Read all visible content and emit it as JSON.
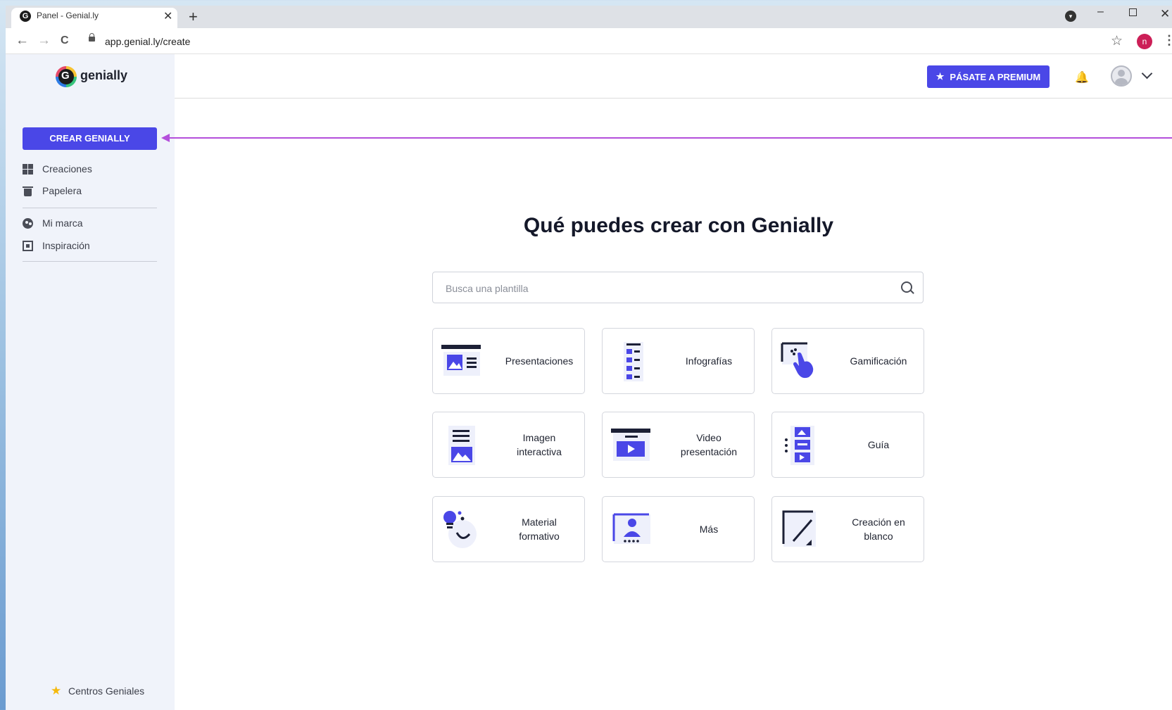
{
  "browser": {
    "tab_title": "Panel - Genial.ly",
    "favicon_letter": "G",
    "tab_close": "✕",
    "new_tab": "+",
    "url": "app.genial.ly/create",
    "profile_initial": "n",
    "icons": {
      "back": "←",
      "forward": "→",
      "reload": "C",
      "star": "☆",
      "kebab": "⋮",
      "minimize": "–",
      "close": "✕"
    }
  },
  "app": {
    "logo_letter": "G",
    "logo_text": "genially",
    "create_button": "CREAR GENIALLY",
    "sidebar": {
      "items": [
        {
          "label": "Creaciones",
          "icon": "grid-icon"
        },
        {
          "label": "Papelera",
          "icon": "trash-icon"
        },
        {
          "label": "Mi marca",
          "icon": "palette-icon"
        },
        {
          "label": "Inspiración",
          "icon": "frame-icon"
        }
      ],
      "footer": "Centros Geniales",
      "footer_icon": "★"
    },
    "header": {
      "premium_button": "PÁSATE A PREMIUM",
      "premium_icon": "★",
      "bell_icon": "🔔"
    },
    "main": {
      "title": "Qué puedes crear con Genially",
      "search_placeholder": "Busca una plantilla",
      "cards": [
        {
          "label": "Presentaciones",
          "icon": "presentation-icon"
        },
        {
          "label": "Infografías",
          "icon": "infographic-icon"
        },
        {
          "label": "Gamificación",
          "icon": "gamification-icon"
        },
        {
          "label": "Imagen\ninteractiva",
          "icon": "interactive-image-icon"
        },
        {
          "label": "Video\npresentación",
          "icon": "video-presentation-icon"
        },
        {
          "label": "Guía",
          "icon": "guide-icon"
        },
        {
          "label": "Material\nformativo",
          "icon": "training-material-icon"
        },
        {
          "label": "Más",
          "icon": "more-icon"
        },
        {
          "label": "Creación en\nblanco",
          "icon": "blank-creation-icon"
        }
      ]
    },
    "colors": {
      "primary": "#4a47e7",
      "annotation_arrow": "#b44fdb",
      "sidebar_bg": "#f0f3fa"
    }
  }
}
